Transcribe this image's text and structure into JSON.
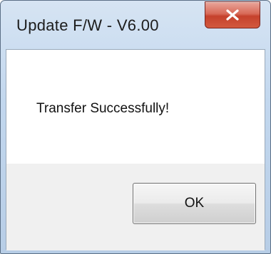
{
  "window": {
    "title": "Update F/W - V6.00"
  },
  "dialog": {
    "message": "Transfer Successfully!",
    "ok_label": "OK"
  },
  "icons": {
    "close": "close-icon"
  },
  "colors": {
    "close_button": "#c5412c",
    "title_bar": "#c2d7ee",
    "button_area": "#f0f0f0"
  }
}
